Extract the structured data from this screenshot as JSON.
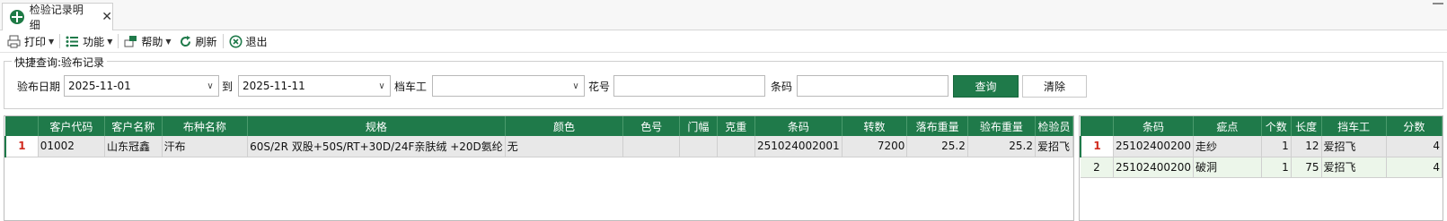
{
  "tab": {
    "title": "检验记录明细",
    "close": "✕"
  },
  "toolbar": {
    "print": "打印",
    "function": "功能",
    "help": "帮助",
    "refresh": "刷新",
    "exit": "退出"
  },
  "query": {
    "group_title": "快捷查询:验布记录",
    "date_label": "验布日期",
    "date_from": "2025-11-01",
    "to_label": "到",
    "date_to": "2025-11-11",
    "worker_label": "档车工",
    "worker_value": "",
    "pattern_label": "花号",
    "pattern_value": "",
    "barcode_label": "条码",
    "barcode_value": "",
    "search_button": "查询",
    "clear_button": "清除"
  },
  "main_grid": {
    "columns": [
      "",
      "客户代码",
      "客户名称",
      "布种名称",
      "规格",
      "颜色",
      "色号",
      "门幅",
      "克重",
      "条码",
      "转数",
      "落布重量",
      "验布重量",
      "检验员"
    ],
    "rows": [
      [
        "1",
        "01002",
        "山东冠鑫",
        "汗布",
        "60S/2R 双股+50S/RT+30D/24F亲肤绒 +20D氨纶",
        "无",
        "",
        "",
        "",
        "251024002001",
        "7200",
        "25.2",
        "25.2",
        "爱招飞"
      ]
    ]
  },
  "defect_grid": {
    "columns": [
      "",
      "条码",
      "疵点",
      "个数",
      "长度",
      "挡车工",
      "分数"
    ],
    "rows": [
      [
        "1",
        "25102400200",
        "走纱",
        "1",
        "12",
        "爱招飞",
        "4"
      ],
      [
        "2",
        "25102400200",
        "破洞",
        "1",
        "75",
        "爱招飞",
        "4"
      ]
    ]
  },
  "colors": {
    "accent": "#1f7a4a",
    "row_number": "#d12b1f",
    "alt_row": "#ecf6ea"
  }
}
